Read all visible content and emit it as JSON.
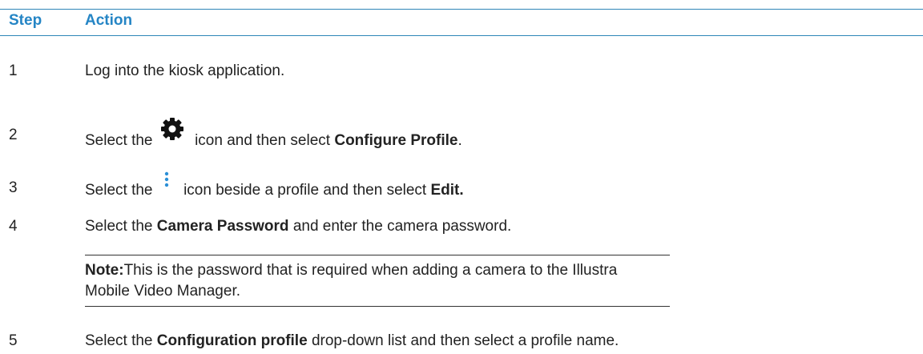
{
  "header": {
    "step_label": "Step",
    "action_label": "Action"
  },
  "accent_color": "#2585c5",
  "steps": [
    {
      "number": "1",
      "text": "Log into the kiosk application."
    },
    {
      "number": "2",
      "pre": "Select the",
      "icon": "gear-icon",
      "mid": "icon and then select",
      "bold": "Configure Profile",
      "post": "."
    },
    {
      "number": "3",
      "pre": "Select the",
      "icon": "vertical-ellipsis-icon",
      "mid": "icon beside a profile and then select",
      "bold": "Edit."
    },
    {
      "number": "4",
      "pre": "Select the",
      "bold": "Camera Password",
      "post": "and enter the camera password."
    },
    {
      "number": "5",
      "pre": "Select the",
      "bold": "Configuration profile",
      "post": "drop-down list and then select a profile name."
    }
  ],
  "note": {
    "label": "Note:",
    "text": "This is the password that is required when adding a camera to the Illustra",
    "text_line2": "Mobile Video Manager."
  }
}
